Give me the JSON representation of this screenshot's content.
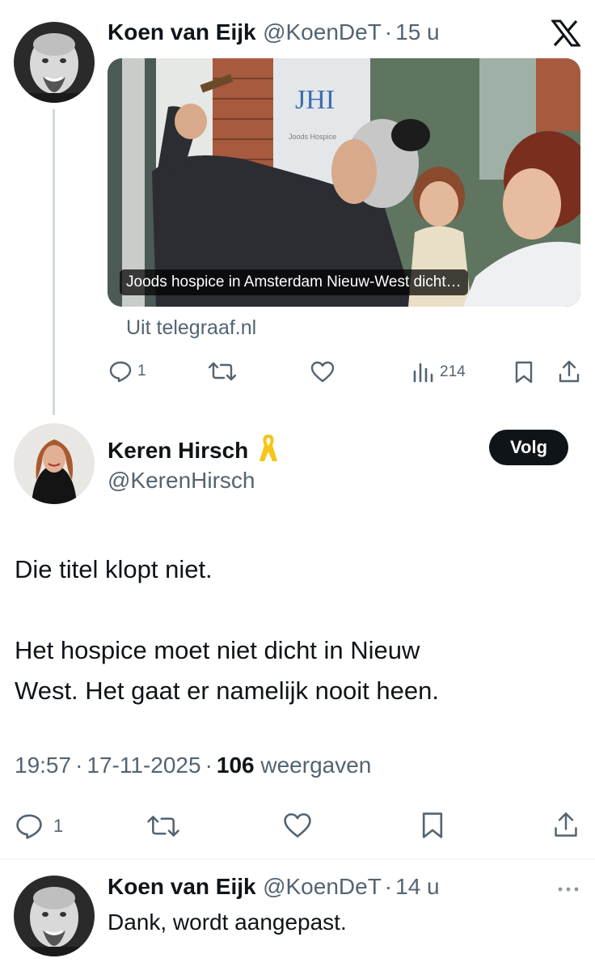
{
  "tweet1": {
    "author_name": "Koen van Eijk",
    "handle": "@KoenDeT",
    "separator": "·",
    "time": "15 u",
    "card_caption": "Joods hospice in Amsterdam Nieuw-West dicht…",
    "card_sign_text": "JHI",
    "card_sign_sub": "Joods Hospice",
    "card_source": "Uit telegraaf.nl",
    "replies": "1",
    "views": "214"
  },
  "main_tweet": {
    "author_name": "Keren Hirsch",
    "handle": "@KerenHirsch",
    "follow_label": "Volg",
    "line1": "Die titel klopt niet.",
    "line2": "Het hospice moet niet dicht in Nieuw",
    "line3": "West. Het gaat er namelijk nooit heen.",
    "meta_time": "19:57",
    "meta_sep1": "·",
    "meta_date": "17-11-2025",
    "meta_sep2": "·",
    "views_count": "106",
    "views_label": "weergaven",
    "replies": "1"
  },
  "reply": {
    "author_name": "Koen van Eijk",
    "handle": "@KoenDeT",
    "separator": "·",
    "time": "14 u",
    "text": "Dank, wordt aangepast."
  },
  "icons": {
    "x_logo": "x-logo-icon",
    "ribbon": "yellow-ribbon-icon",
    "more": "more-icon"
  },
  "colors": {
    "text": "#0f1419",
    "secondary": "#536471",
    "ribbon": "#f5c518",
    "thread_line": "#cfd9de"
  }
}
